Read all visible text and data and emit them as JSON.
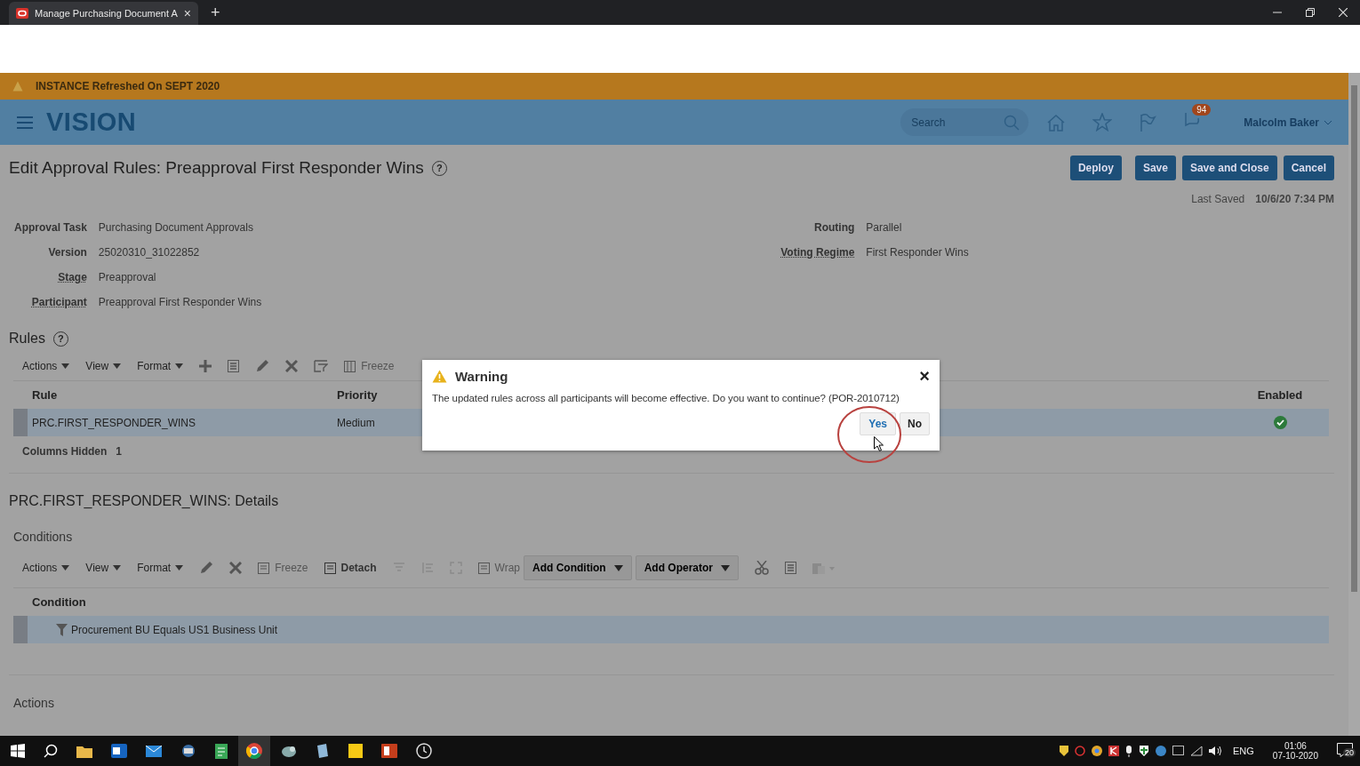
{
  "browser_tab": {
    "title": "Manage Purchasing Document A",
    "close": "×",
    "new_tab": "+"
  },
  "banner": {
    "text": "INSTANCE Refreshed On SEPT 2020"
  },
  "header": {
    "logo": "VISION",
    "search": {
      "placeholder": "Search"
    },
    "notification_count": "94",
    "user": "Malcolm Baker"
  },
  "page": {
    "title": "Edit Approval Rules: Preapproval First Responder Wins",
    "help": "?",
    "buttons": [
      "Deploy",
      "Save",
      "Save and Close",
      "Cancel"
    ],
    "last_saved": {
      "label": "Last Saved",
      "value": "10/6/20 7:34 PM"
    },
    "fields_left": [
      {
        "label": "Approval Task",
        "value": "Purchasing Document Approvals",
        "underlined": false
      },
      {
        "label": "Version",
        "value": "25020310_31022852",
        "underlined": false
      },
      {
        "label": "Stage",
        "value": "Preapproval",
        "underlined": true
      },
      {
        "label": "Participant",
        "value": "Preapproval First Responder Wins",
        "underlined": true
      }
    ],
    "fields_right": [
      {
        "label": "Routing",
        "value": "Parallel",
        "underlined": false
      },
      {
        "label": "Voting Regime",
        "value": "First Responder Wins",
        "underlined": true
      }
    ]
  },
  "rules": {
    "title": "Rules",
    "help": "?",
    "menus": [
      "Actions",
      "View",
      "Format"
    ],
    "freeze": {
      "label": "Freeze",
      "disabled": true
    },
    "columns": [
      "Rule",
      "Priority",
      "Enabled"
    ],
    "rows": [
      {
        "rule": "PRC.FIRST_RESPONDER_WINS",
        "priority": "Medium",
        "enabled": true,
        "selected": true
      }
    ],
    "hidden": {
      "label": "Columns Hidden",
      "value": "1"
    }
  },
  "details": {
    "title": "PRC.FIRST_RESPONDER_WINS: Details",
    "conditions_title": "Conditions",
    "menus": [
      "Actions",
      "View",
      "Format"
    ],
    "tools": [
      {
        "label": "Freeze",
        "disabled": true
      },
      {
        "label": "Detach",
        "disabled": false
      },
      {
        "label": "Wrap",
        "disabled": true
      }
    ],
    "dropdowns": [
      "Add Condition",
      "Add Operator"
    ],
    "columns": [
      "Condition"
    ],
    "rows": [
      {
        "text": "Procurement BU Equals US1 Business Unit",
        "selected": true
      }
    ],
    "actions_title": "Actions"
  },
  "dialog": {
    "title": "Warning",
    "close": "×",
    "message": "The updated rules across all participants will become effective. Do you want to continue? (POR-2010712)",
    "buttons": [
      {
        "label": "Yes",
        "focused": true
      },
      {
        "label": "No",
        "focused": false
      }
    ]
  },
  "taskbar": {
    "language": "ENG",
    "time": "01:06",
    "date": "07-10-2020",
    "notifications": "20"
  }
}
